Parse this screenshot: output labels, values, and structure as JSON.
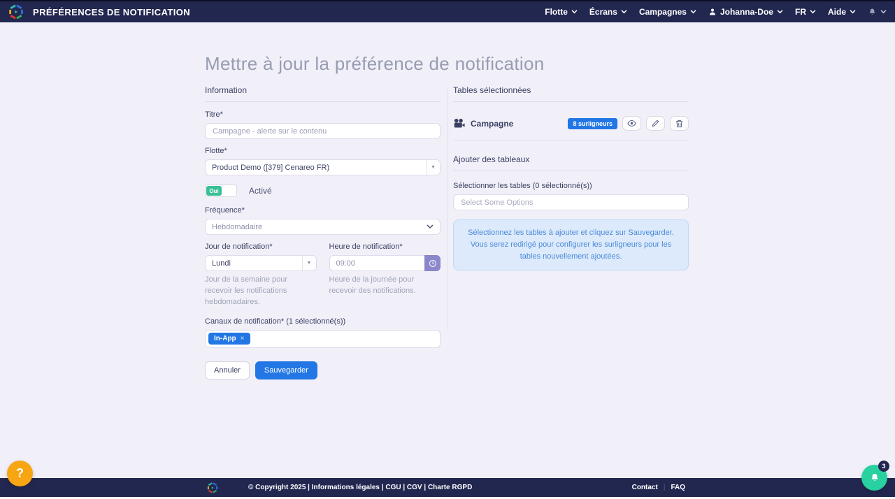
{
  "colors": {
    "navy": "#222750",
    "accent_blue": "#2277e5",
    "toggle_green": "#3abf96",
    "clock_purple": "#8b87cb",
    "help_orange": "#f8a513",
    "notif_teal": "#29d0a0"
  },
  "navbar": {
    "title": "PRÉFÉRENCES DE NOTIFICATION",
    "items": [
      {
        "label": "Flotte"
      },
      {
        "label": "Écrans"
      },
      {
        "label": "Campagnes"
      },
      {
        "label": "Johanna-Doe"
      },
      {
        "label": "FR"
      },
      {
        "label": "Aide"
      }
    ]
  },
  "page": {
    "title": "Mettre à jour la préférence de notification"
  },
  "form": {
    "section_title": "Information",
    "titre_label": "Titre*",
    "titre_value": "Campagne - alerte sur le contenu",
    "flotte_label": "Flotte*",
    "flotte_value": "Product Demo ([379] Cenareo FR)",
    "toggle_on": "Oui",
    "toggle_label": "Activé",
    "frequence_label": "Fréquence*",
    "frequence_value": "Hebdomadaire",
    "jour_label": "Jour de notification*",
    "jour_value": "Lundi",
    "jour_help": "Jour de la semaine pour recevoir les notifications hebdomadaires.",
    "heure_label": "Heure de notification*",
    "heure_value": "09:00",
    "heure_help": "Heure de la journée pour recevoir des notifications.",
    "canaux_label": "Canaux de notification* (1 sélectionné(s))",
    "canaux_tag": "In-App",
    "tag_remove": "×",
    "cancel_label": "Annuler",
    "save_label": "Sauvegarder"
  },
  "tables": {
    "selected_title": "Tables sélectionnées",
    "row": {
      "name": "Campagne",
      "badge": "8 surligneurs"
    },
    "add_title": "Ajouter des tableaux",
    "select_label": "Sélectionner les tables (0 sélectionné(s))",
    "select_placeholder": "Select Some Options",
    "info_text": "Sélectionnez les tables à ajouter et cliquez sur Sauvegarder. Vous serez redirigé pour configurer les surligneurs pour les tables nouvellement ajoutées."
  },
  "footer": {
    "copyright": "© Copyright 2025 | Informations légales | CGU | CGV | Charte RGPD",
    "contact": "Contact",
    "faq": "FAQ"
  },
  "floating": {
    "help_label": "?",
    "notif_count": "3"
  }
}
